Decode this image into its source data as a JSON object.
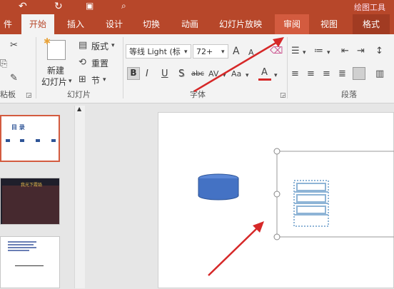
{
  "titlebar": {
    "tool_context": "绘图工具"
  },
  "tabs": [
    "件",
    "开始",
    "插入",
    "设计",
    "切换",
    "动画",
    "幻灯片放映",
    "审阅",
    "视图",
    "格式"
  ],
  "ribbon": {
    "groups": {
      "clipboard": "粘板",
      "slides": "幻灯片",
      "font": "字体",
      "paragraph": "段落"
    },
    "new_slide": [
      "新建",
      "幻灯片"
    ],
    "slide_cmds": {
      "layout": "版式",
      "reset": "重置",
      "section": "节"
    },
    "font_name": "等线 Light (标",
    "font_size": "72+",
    "format_labels": {
      "bold": "B",
      "italic": "I",
      "underline": "U",
      "shadow": "S",
      "strike": "abc",
      "spacing": "AV",
      "case": "Aa",
      "color": "A",
      "grow": "A",
      "shrink": "A"
    }
  },
  "thumbnails": {
    "slide1": {
      "title": "目  录"
    },
    "slide2": {
      "title": "我光下霞铅"
    }
  },
  "colors": {
    "accent": "#b7472a",
    "accent_light": "#d35b3f",
    "arrow": "#d62828",
    "cylinder": "#4472c4"
  }
}
